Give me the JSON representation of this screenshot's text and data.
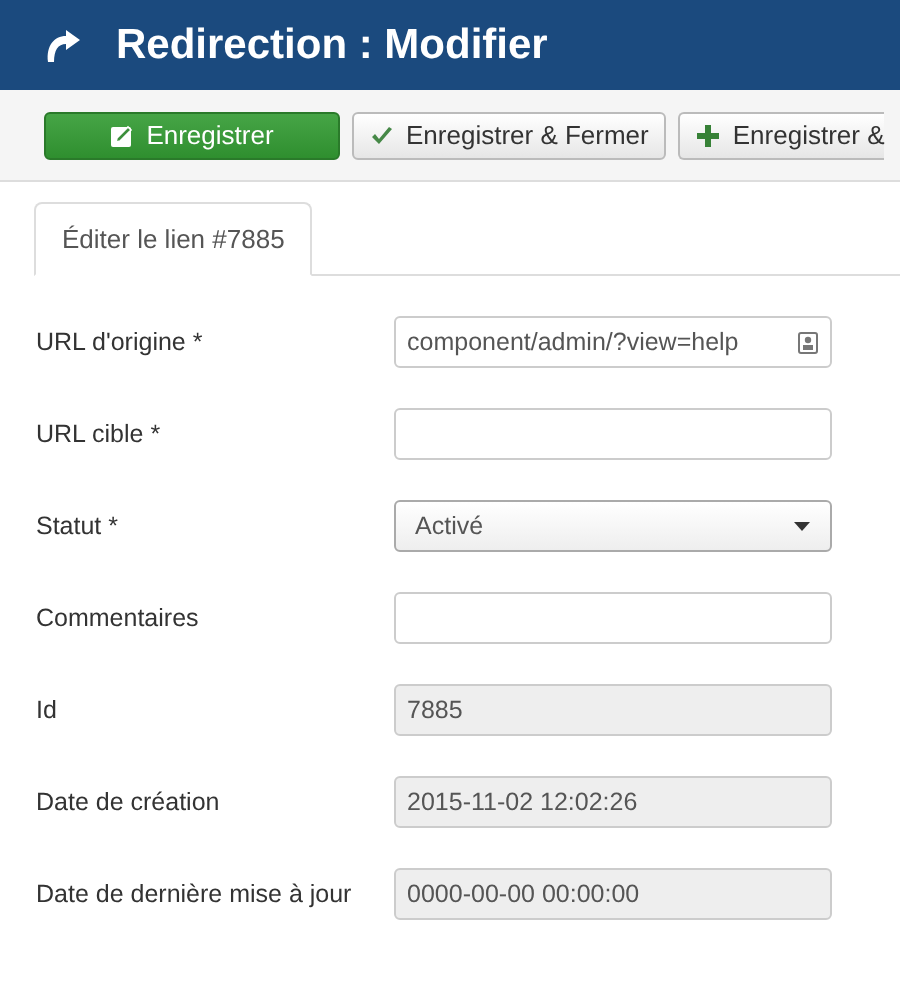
{
  "header": {
    "title": "Redirection : Modifier"
  },
  "toolbar": [
    {
      "label": "Enregistrer",
      "kind": "save"
    },
    {
      "label": "Enregistrer & Fermer",
      "kind": "save_close"
    },
    {
      "label": "Enregistrer &",
      "kind": "save_new"
    }
  ],
  "tabs": [
    {
      "label": "Éditer le lien #7885",
      "selected": true
    }
  ],
  "fields": [
    {
      "label": "URL d'origine *",
      "kind": "text",
      "value": "component/admin/?view=help",
      "has_icon": true
    },
    {
      "label": "URL cible *",
      "kind": "text"
    },
    {
      "label": "Statut *",
      "kind": "select",
      "value": "Activé"
    },
    {
      "label": "Commentaires",
      "kind": "text"
    },
    {
      "label": "Id",
      "kind": "readonly",
      "value": "7885"
    },
    {
      "label": "Date de création",
      "kind": "readonly",
      "value": "2015-11-02 12:02:26"
    },
    {
      "label": "Date de dernière mise à jour",
      "kind": "readonly",
      "value": "0000-00-00 00:00:00"
    }
  ]
}
